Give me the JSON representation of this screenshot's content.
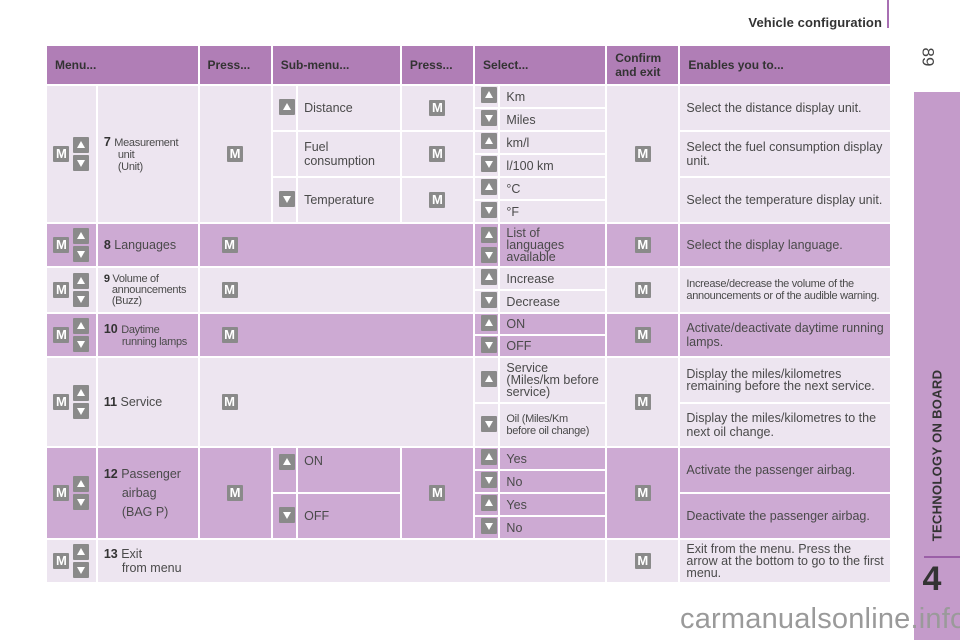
{
  "header": {
    "title": "Vehicle configuration",
    "page_number": "89"
  },
  "side_tab": {
    "label": "TECHNOLOGY ON BOARD",
    "chapter": "4"
  },
  "watermark": "carmanualsonline.info",
  "table": {
    "columns": [
      "Menu...",
      "Press...",
      "Sub-menu...",
      "Press...",
      "Select...",
      "Confirm and exit",
      "Enables you to..."
    ],
    "keys": {
      "menu_key": "M",
      "up_icon": "arrow-up-icon",
      "down_icon": "arrow-down-icon"
    },
    "rows": [
      {
        "num": "7",
        "menu": "Measurement",
        "menu2": "unit",
        "menu3": "(Unit)",
        "submenus": [
          {
            "label": "Distance",
            "arrow": "up",
            "options": [
              "Km",
              "Miles"
            ],
            "enables": "Select the distance display unit."
          },
          {
            "label": "Fuel consumption",
            "arrow": "",
            "options": [
              "km/l",
              "l/100 km"
            ],
            "enables": "Select the fuel consumption display unit."
          },
          {
            "label": "Temperature",
            "arrow": "down",
            "options": [
              "°C",
              "°F"
            ],
            "enables": "Select the temperature display unit."
          }
        ]
      },
      {
        "num": "8",
        "menu": "Languages",
        "options": [
          "List of languages available"
        ],
        "enables": "Select the display language."
      },
      {
        "num": "9",
        "menu": "Volume of",
        "menu2": "announcements",
        "menu3": "(Buzz)",
        "options": [
          "Increase",
          "Decrease"
        ],
        "enables": "Increase/decrease the volume of the announcements or of the audible warning."
      },
      {
        "num": "10",
        "menu": "Daytime",
        "menu2": "running lamps",
        "options": [
          "ON",
          "OFF"
        ],
        "enables": "Activate/deactivate daytime running lamps."
      },
      {
        "num": "11",
        "menu": "Service",
        "options": [
          "Service (Miles/km before service)",
          "Oil (Miles/Km before oil change)"
        ],
        "enables": [
          "Display the miles/kilometres remaining before the next service.",
          "Display the miles/kilometres to the next oil change."
        ]
      },
      {
        "num": "12",
        "menu": "Passenger",
        "menu2": "airbag",
        "menu3": "(BAG P)",
        "submenus": [
          {
            "label": "ON",
            "arrow": "up",
            "options": [
              "Yes",
              "No"
            ],
            "enables": "Activate the passenger airbag."
          },
          {
            "label": "OFF",
            "arrow": "down",
            "options": [
              "Yes",
              "No"
            ],
            "enables": "Deactivate the passenger airbag."
          }
        ]
      },
      {
        "num": "13",
        "menu": "Exit",
        "menu2": "from menu",
        "enables": "Exit from the menu. Press the arrow at the bottom to go to the first menu."
      }
    ]
  }
}
